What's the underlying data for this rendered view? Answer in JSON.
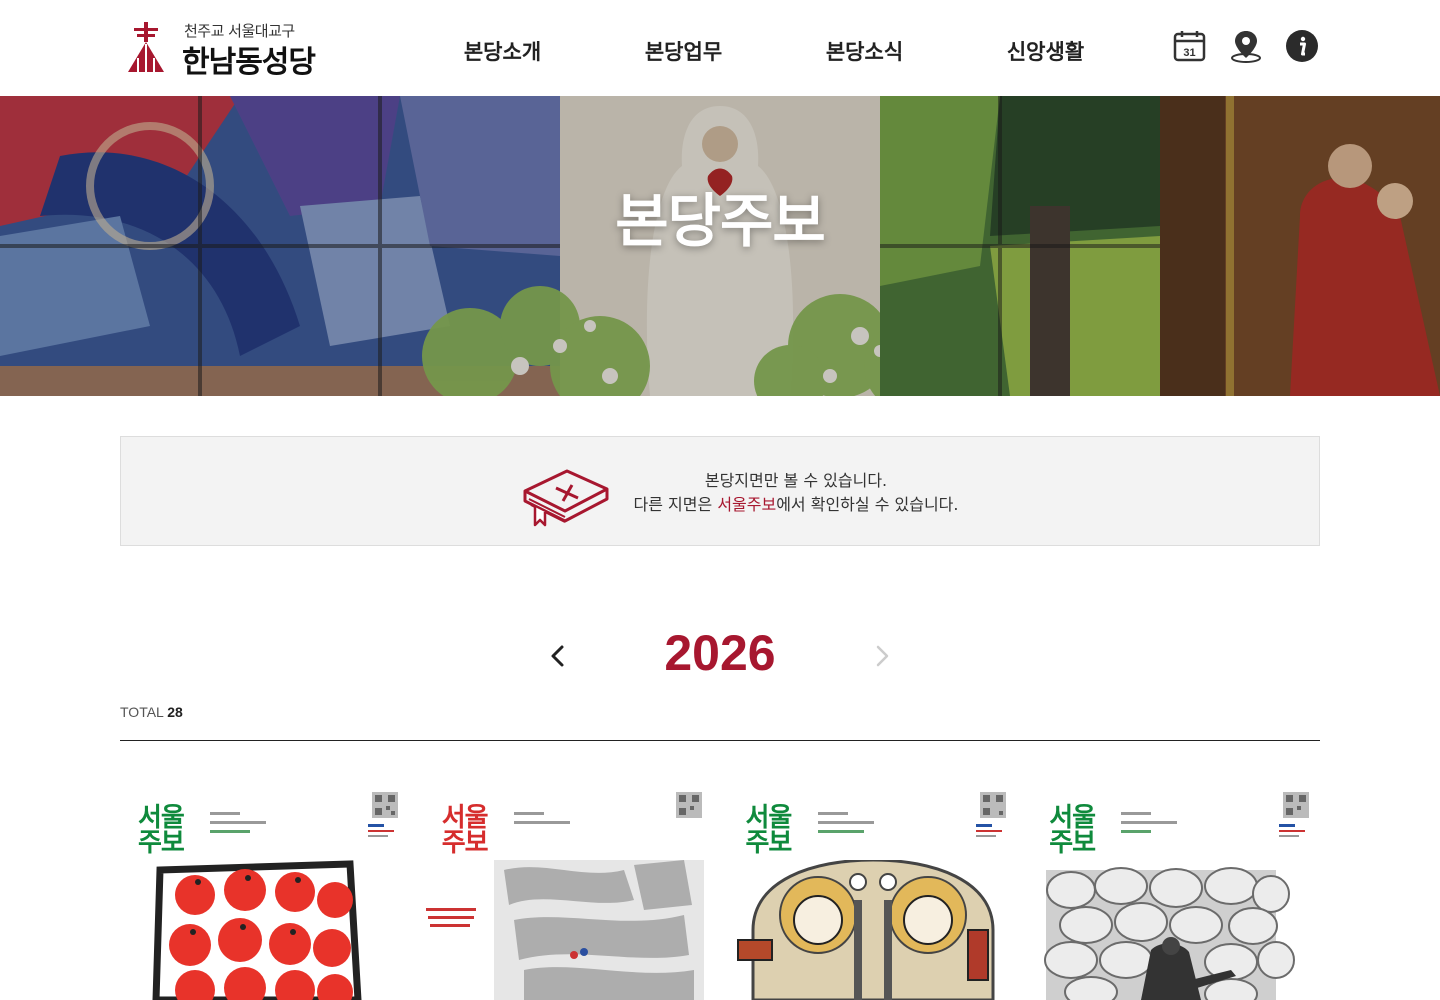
{
  "header": {
    "logo_sub": "천주교 서울대교구",
    "logo_main": "한남동성당",
    "nav": [
      "본당소개",
      "본당업무",
      "본당소식",
      "신앙생활"
    ],
    "calendar_day": "31"
  },
  "hero": {
    "title": "본당주보"
  },
  "notice": {
    "line1": "본당지면만 볼 수 있습니다.",
    "line2_prefix": "다른 지면은 ",
    "line2_link": "서울주보",
    "line2_suffix": "에서 확인하실 수 있습니다."
  },
  "archive": {
    "year": "2026",
    "total_label": "TOTAL",
    "total_count": "28"
  },
  "bulletins": [
    {
      "cover_title_1": "서울",
      "cover_title_2": "주보",
      "title_color": "green"
    },
    {
      "cover_title_1": "서울",
      "cover_title_2": "주보",
      "title_color": "red"
    },
    {
      "cover_title_1": "서울",
      "cover_title_2": "주보",
      "title_color": "green"
    },
    {
      "cover_title_1": "서울",
      "cover_title_2": "주보",
      "title_color": "green"
    }
  ],
  "colors": {
    "accent": "#a7172f",
    "notice_bg": "#f3f3f3"
  },
  "icons": [
    "calendar-icon",
    "location-pin-icon",
    "info-icon",
    "bible-icon",
    "chevron-left-icon",
    "chevron-right-icon"
  ]
}
